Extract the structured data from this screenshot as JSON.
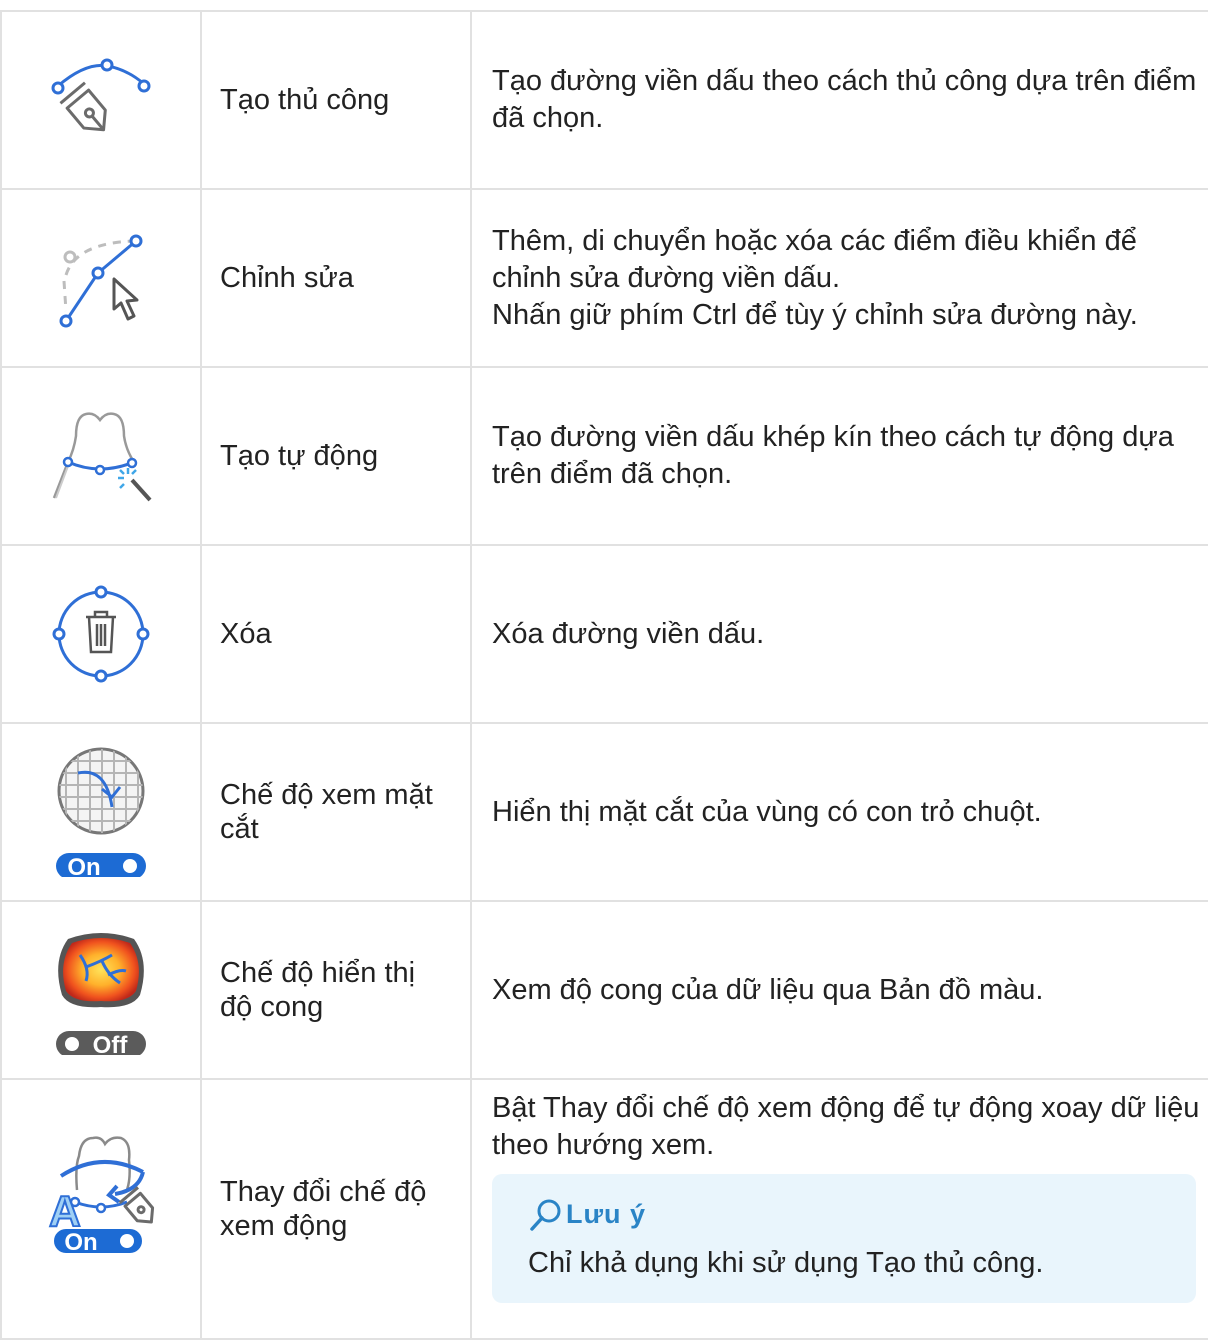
{
  "rows": [
    {
      "icon": "pen-spline-icon",
      "name": "Tạo thủ công",
      "desc": [
        "Tạo đường viền dấu theo cách thủ công dựa trên điểm đã chọn."
      ]
    },
    {
      "icon": "edit-spline-cursor-icon",
      "name": "Chỉnh sửa",
      "desc": [
        "Thêm, di chuyển hoặc xóa các điểm điều khiển để chỉnh sửa đường viền dấu.",
        "Nhấn giữ phím Ctrl để tùy ý chỉnh sửa đường này."
      ]
    },
    {
      "icon": "auto-margin-wand-icon",
      "name": "Tạo tự động",
      "desc": [
        "Tạo đường viền dấu khép kín theo cách tự động dựa trên điểm đã chọn."
      ]
    },
    {
      "icon": "delete-margin-trash-icon",
      "name": "Xóa",
      "desc": [
        "Xóa đường viền dấu."
      ]
    },
    {
      "icon": "cross-section-view-icon",
      "toggle": "On",
      "name": "Chế độ xem mặt cắt",
      "desc": [
        "Hiển thị mặt cắt của vùng có con trỏ chuột."
      ]
    },
    {
      "icon": "curvature-map-icon",
      "toggle": "Off",
      "name": "Chế độ hiển thị độ cong",
      "desc": [
        "Xem độ cong của dữ liệu qua Bản đồ màu."
      ]
    },
    {
      "icon": "dynamic-view-rotate-icon",
      "toggle": "On",
      "name": "Thay đổi chế độ xem động",
      "desc": [
        "Bật Thay đổi chế độ xem động để tự động xoay dữ liệu theo hướng xem."
      ],
      "note": {
        "title": "Lưu ý",
        "text": "Chỉ khả dụng khi sử dụng Tạo thủ công."
      }
    }
  ],
  "colors": {
    "accent": "#2f6fd6",
    "toggle_on": "#1d6bd4",
    "toggle_off": "#5b5b5b",
    "note_bg": "#e9f5fc",
    "note_title": "#2a84c6"
  }
}
